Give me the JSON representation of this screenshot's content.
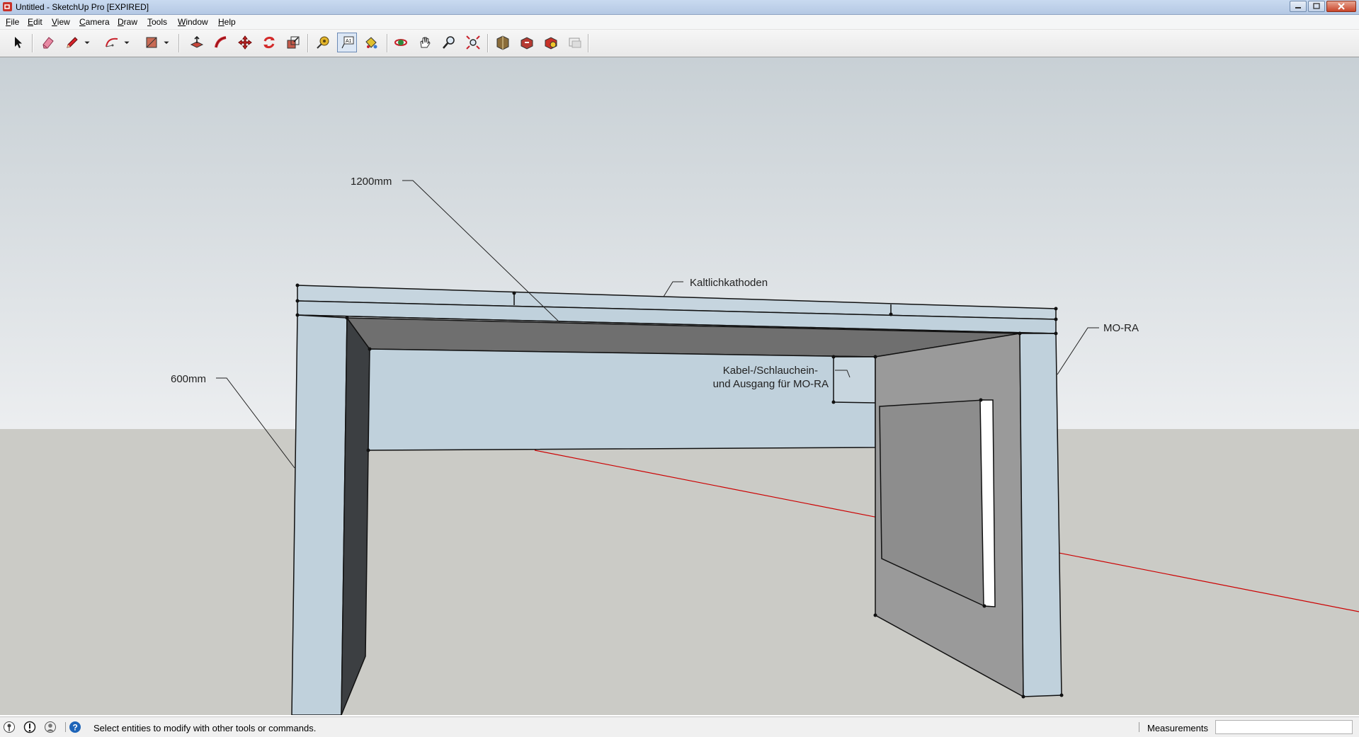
{
  "window": {
    "title": "Untitled - SketchUp Pro [EXPIRED]",
    "app_icon": "sketchup-logo-icon",
    "controls": [
      "minimize-icon",
      "maximize-icon",
      "close-icon"
    ]
  },
  "menu": {
    "items": [
      "File",
      "Edit",
      "View",
      "Camera",
      "Draw",
      "Tools",
      "Window",
      "Help"
    ]
  },
  "toolbar": {
    "tools": [
      {
        "name": "select-icon"
      },
      {
        "name": "eraser-icon"
      },
      {
        "name": "pencil-icon"
      },
      {
        "name": "arc-icon"
      },
      {
        "name": "rectangle-icon"
      },
      {
        "name": "push-pull-icon"
      },
      {
        "name": "follow-me-icon"
      },
      {
        "name": "move-icon"
      },
      {
        "name": "rotate-icon"
      },
      {
        "name": "scale-icon"
      },
      {
        "name": "tape-measure-icon"
      },
      {
        "name": "text-icon",
        "active": true
      },
      {
        "name": "paint-bucket-icon"
      },
      {
        "name": "orbit-icon"
      },
      {
        "name": "pan-icon"
      },
      {
        "name": "zoom-icon"
      },
      {
        "name": "zoom-extents-icon"
      },
      {
        "name": "3d-warehouse-icon"
      },
      {
        "name": "share-model-icon"
      },
      {
        "name": "extension-warehouse-icon"
      },
      {
        "name": "send-to-layout-icon"
      }
    ]
  },
  "scene": {
    "labels": {
      "width": "1200mm",
      "depth": "600mm",
      "top_strip": "Kaltlichkathoden",
      "right_panel": "MO-RA",
      "cutout_line1": "Kabel-/Schlauchein-",
      "cutout_line2": "und Ausgang für MO-RA"
    },
    "colors": {
      "sky_top": "#c8d0d5",
      "sky_bottom": "#e8ecee",
      "ground": "#cbcbc6",
      "panel_face": "#c0d1dc",
      "dark_face": "#3c3f42",
      "inner_top": "#6f6f6f",
      "side_panel": "#9a9a9a",
      "axis_red": "#cc0000"
    }
  },
  "status": {
    "help_text": "Select entities to modify with other tools or commands.",
    "measurements_label": "Measurements",
    "measurements_value": "",
    "icons": [
      "geo-location-icon",
      "credits-icon",
      "user-icon",
      "help-icon"
    ]
  }
}
